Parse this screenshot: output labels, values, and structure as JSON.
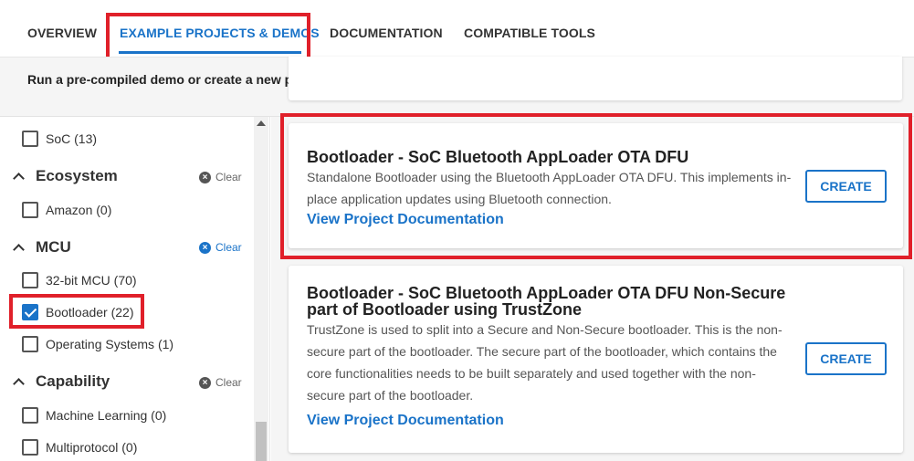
{
  "tabs": [
    {
      "label": "OVERVIEW"
    },
    {
      "label": "EXAMPLE PROJECTS & DEMOS"
    },
    {
      "label": "DOCUMENTATION"
    },
    {
      "label": "COMPATIBLE TOOLS"
    }
  ],
  "active_tab": "EXAMPLE PROJECTS & DEMOS",
  "description": "Run a pre-compiled demo or create a new project based on a software example.",
  "sidebar": {
    "soc_item": {
      "label": "SoC (13)",
      "checked": false
    },
    "ecosystem": {
      "title": "Ecosystem",
      "clear_label": "Clear",
      "items": [
        {
          "label": "Amazon (0)",
          "checked": false
        }
      ]
    },
    "mcu": {
      "title": "MCU",
      "clear_label": "Clear",
      "items": [
        {
          "label": "32-bit MCU (70)",
          "checked": false
        },
        {
          "label": "Bootloader (22)",
          "checked": true
        },
        {
          "label": "Operating Systems (1)",
          "checked": false
        }
      ]
    },
    "capability": {
      "title": "Capability",
      "clear_label": "Clear",
      "items": [
        {
          "label": "Machine Learning (0)",
          "checked": false
        },
        {
          "label": "Multiprotocol (0)",
          "checked": false
        }
      ]
    }
  },
  "cards": [
    {
      "title": "Bootloader - SoC Bluetooth AppLoader OTA DFU",
      "desc_lines": [
        "Standalone Bootloader using the Bluetooth AppLoader OTA DFU. This implements in-",
        "place application updates using Bluetooth connection."
      ],
      "link": "View Project Documentation",
      "button": "CREATE"
    },
    {
      "title_lines": [
        "Bootloader - SoC Bluetooth AppLoader OTA DFU Non-Secure",
        "part of Bootloader using TrustZone"
      ],
      "desc_lines": [
        "TrustZone is used to split into a Secure and Non-Secure bootloader. This is the non-",
        "secure part of the bootloader. The secure part of the bootloader, which contains the",
        "core functionalities needs to be built separately and used together with the non-",
        "secure part of the bootloader."
      ],
      "link": "View Project Documentation",
      "button": "CREATE"
    }
  ],
  "colors": {
    "accent": "#1a73c8",
    "highlight": "#e0202a"
  }
}
